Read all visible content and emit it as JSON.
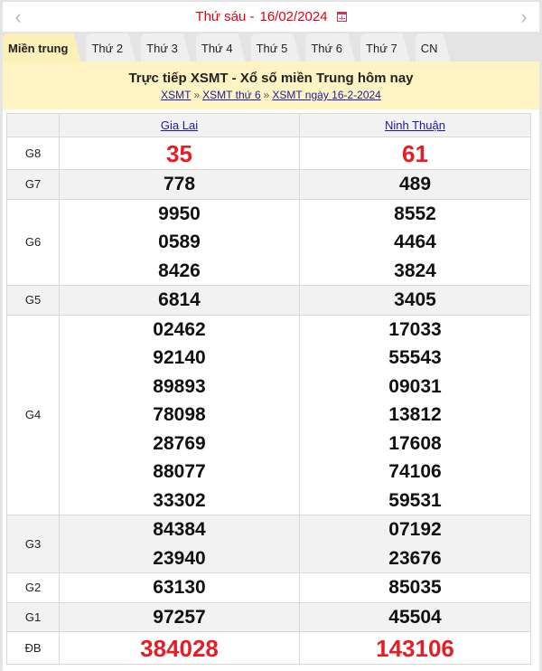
{
  "date_bar": {
    "day_label": "Thứ sáu -",
    "date": "16/02/2024",
    "prev_icon": "chevron-left-icon",
    "next_icon": "chevron-right-icon",
    "calendar_icon": "calendar-icon"
  },
  "tabs": [
    {
      "label": "Miền trung",
      "active": true
    },
    {
      "label": "Thứ 2"
    },
    {
      "label": "Thứ 3"
    },
    {
      "label": "Thứ 4"
    },
    {
      "label": "Thứ 5"
    },
    {
      "label": "Thứ 6"
    },
    {
      "label": "Thứ 7"
    },
    {
      "label": "CN"
    }
  ],
  "headline": "Trực tiếp XSMT - Xổ số miền Trung hôm nay",
  "breadcrumb": {
    "items": [
      "XSMT",
      "XSMT thứ 6",
      "XSMT ngày 16-2-2024"
    ],
    "separator": "»"
  },
  "results": {
    "provinces": [
      "Gia Lai",
      "Ninh Thuận"
    ],
    "colors": {
      "highlight": "#e51e25",
      "normal": "#111111"
    },
    "prizes": [
      {
        "label": "G8",
        "gia_lai": [
          "35"
        ],
        "ninh_thuan": [
          "61"
        ]
      },
      {
        "label": "G7",
        "gia_lai": [
          "778"
        ],
        "ninh_thuan": [
          "489"
        ]
      },
      {
        "label": "G6",
        "gia_lai": [
          "9950",
          "0589",
          "8426"
        ],
        "ninh_thuan": [
          "8552",
          "4464",
          "3824"
        ]
      },
      {
        "label": "G5",
        "gia_lai": [
          "6814"
        ],
        "ninh_thuan": [
          "3405"
        ]
      },
      {
        "label": "G4",
        "gia_lai": [
          "02462",
          "92140",
          "89893",
          "78098",
          "28769",
          "88077",
          "33302"
        ],
        "ninh_thuan": [
          "17033",
          "55543",
          "09031",
          "13812",
          "17608",
          "74106",
          "59531"
        ]
      },
      {
        "label": "G3",
        "gia_lai": [
          "84384",
          "23940"
        ],
        "ninh_thuan": [
          "07192",
          "23676"
        ]
      },
      {
        "label": "G2",
        "gia_lai": [
          "63130"
        ],
        "ninh_thuan": [
          "85035"
        ]
      },
      {
        "label": "G1",
        "gia_lai": [
          "97257"
        ],
        "ninh_thuan": [
          "45504"
        ]
      },
      {
        "label": "ĐB",
        "gia_lai": [
          "384028"
        ],
        "ninh_thuan": [
          "143106"
        ]
      }
    ]
  }
}
